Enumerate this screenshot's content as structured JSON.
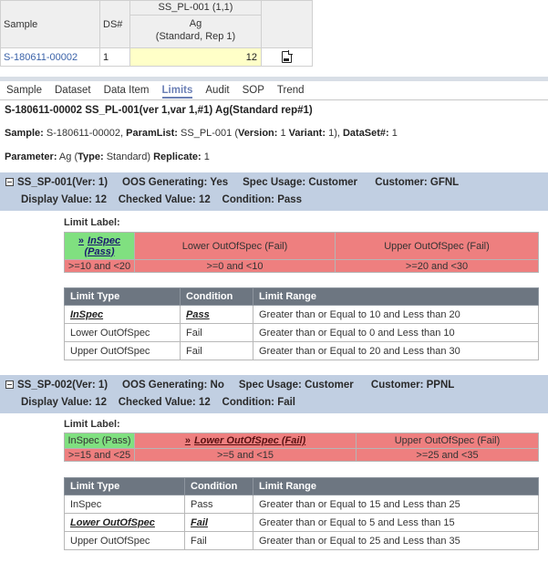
{
  "grid": {
    "header_sample": "Sample",
    "header_ds": "DS#",
    "header_paramlist": "SS_PL-001 (1,1)",
    "header_param": "Ag",
    "header_param_sub": "(Standard, Rep 1)",
    "row_sample": "S-180611-00002",
    "row_ds": "1",
    "row_value": "12",
    "doc_icon": "pdf-document-icon"
  },
  "tabs": [
    "Sample",
    "Dataset",
    "Data Item",
    "Limits",
    "Audit",
    "SOP",
    "Trend"
  ],
  "active_tab": "Limits",
  "title": "S-180611-00002 SS_PL-001(ver 1,var 1,#1) Ag(Standard rep#1)",
  "sample_info": {
    "sample_label": "Sample:",
    "sample_value": " S-180611-00002, ",
    "paramlist_label": "ParamList:",
    "paramlist_value": " SS_PL-001 (",
    "version_label": "Version:",
    "version_value": " 1 ",
    "variant_label": "Variant:",
    "variant_value": " 1), ",
    "dataset_label": "DataSet#:",
    "dataset_value": " 1"
  },
  "param_info": {
    "param_label": "Parameter:",
    "param_value": " Ag (",
    "type_label": "Type:",
    "type_value": " Standard) ",
    "replicate_label": "Replicate:",
    "replicate_value": " 1"
  },
  "specs": [
    {
      "line1": "SS_SP-001(Ver: 1)     OOS Generating: Yes     Spec Usage: Customer      Customer: GFNL",
      "line2": "Display Value: 12    Checked Value: 12    Condition: Pass",
      "limit_label": "Limit Label:",
      "bands": [
        {
          "name": "InSpec (Pass)",
          "range": ">=10 and <20",
          "color": "#80e080",
          "current": true
        },
        {
          "name": "Lower OutOfSpec (Fail)",
          "range": ">=0 and <10",
          "color": "#ee7f7f",
          "current": false
        },
        {
          "name": "Upper OutOfSpec (Fail)",
          "range": ">=20 and <30",
          "color": "#ee7f7f",
          "current": false
        }
      ],
      "table_headers": [
        "Limit Type",
        "Condition",
        "Limit Range"
      ],
      "rows": [
        {
          "type": "InSpec",
          "condition": "Pass",
          "range": "Greater than or Equal to 10 and Less than 20",
          "current": true
        },
        {
          "type": "Lower OutOfSpec",
          "condition": "Fail",
          "range": "Greater than or Equal to 0 and Less than 10",
          "current": false
        },
        {
          "type": "Upper OutOfSpec",
          "condition": "Fail",
          "range": "Greater than or Equal to 20 and Less than 30",
          "current": false
        }
      ]
    },
    {
      "line1": "SS_SP-002(Ver: 1)     OOS Generating: No     Spec Usage: Customer      Customer: PPNL",
      "line2": "Display Value: 12    Checked Value: 12    Condition: Fail",
      "limit_label": "Limit Label:",
      "bands": [
        {
          "name": "InSpec (Pass)",
          "range": ">=15 and <25",
          "color": "#80e080",
          "current": false
        },
        {
          "name": "Lower OutOfSpec (Fail)",
          "range": ">=5 and <15",
          "color": "#ee7f7f",
          "current": true
        },
        {
          "name": "Upper OutOfSpec (Fail)",
          "range": ">=25 and <35",
          "color": "#ee7f7f",
          "current": false
        }
      ],
      "table_headers": [
        "Limit Type",
        "Condition",
        "Limit Range"
      ],
      "rows": [
        {
          "type": "InSpec",
          "condition": "Pass",
          "range": "Greater than or Equal to 15 and Less than 25",
          "current": false
        },
        {
          "type": "Lower OutOfSpec",
          "condition": "Fail",
          "range": "Greater than or Equal to 5 and Less than 15",
          "current": true
        },
        {
          "type": "Upper OutOfSpec",
          "condition": "Fail",
          "range": "Greater than or Equal to 25 and Less than 35",
          "current": false
        }
      ]
    }
  ],
  "colors": {
    "accent": "#6b7fb5",
    "spec_header": "#c1cfe2",
    "pass": "#80e080",
    "fail": "#ee7f7f",
    "table_header": "#6d7681"
  }
}
